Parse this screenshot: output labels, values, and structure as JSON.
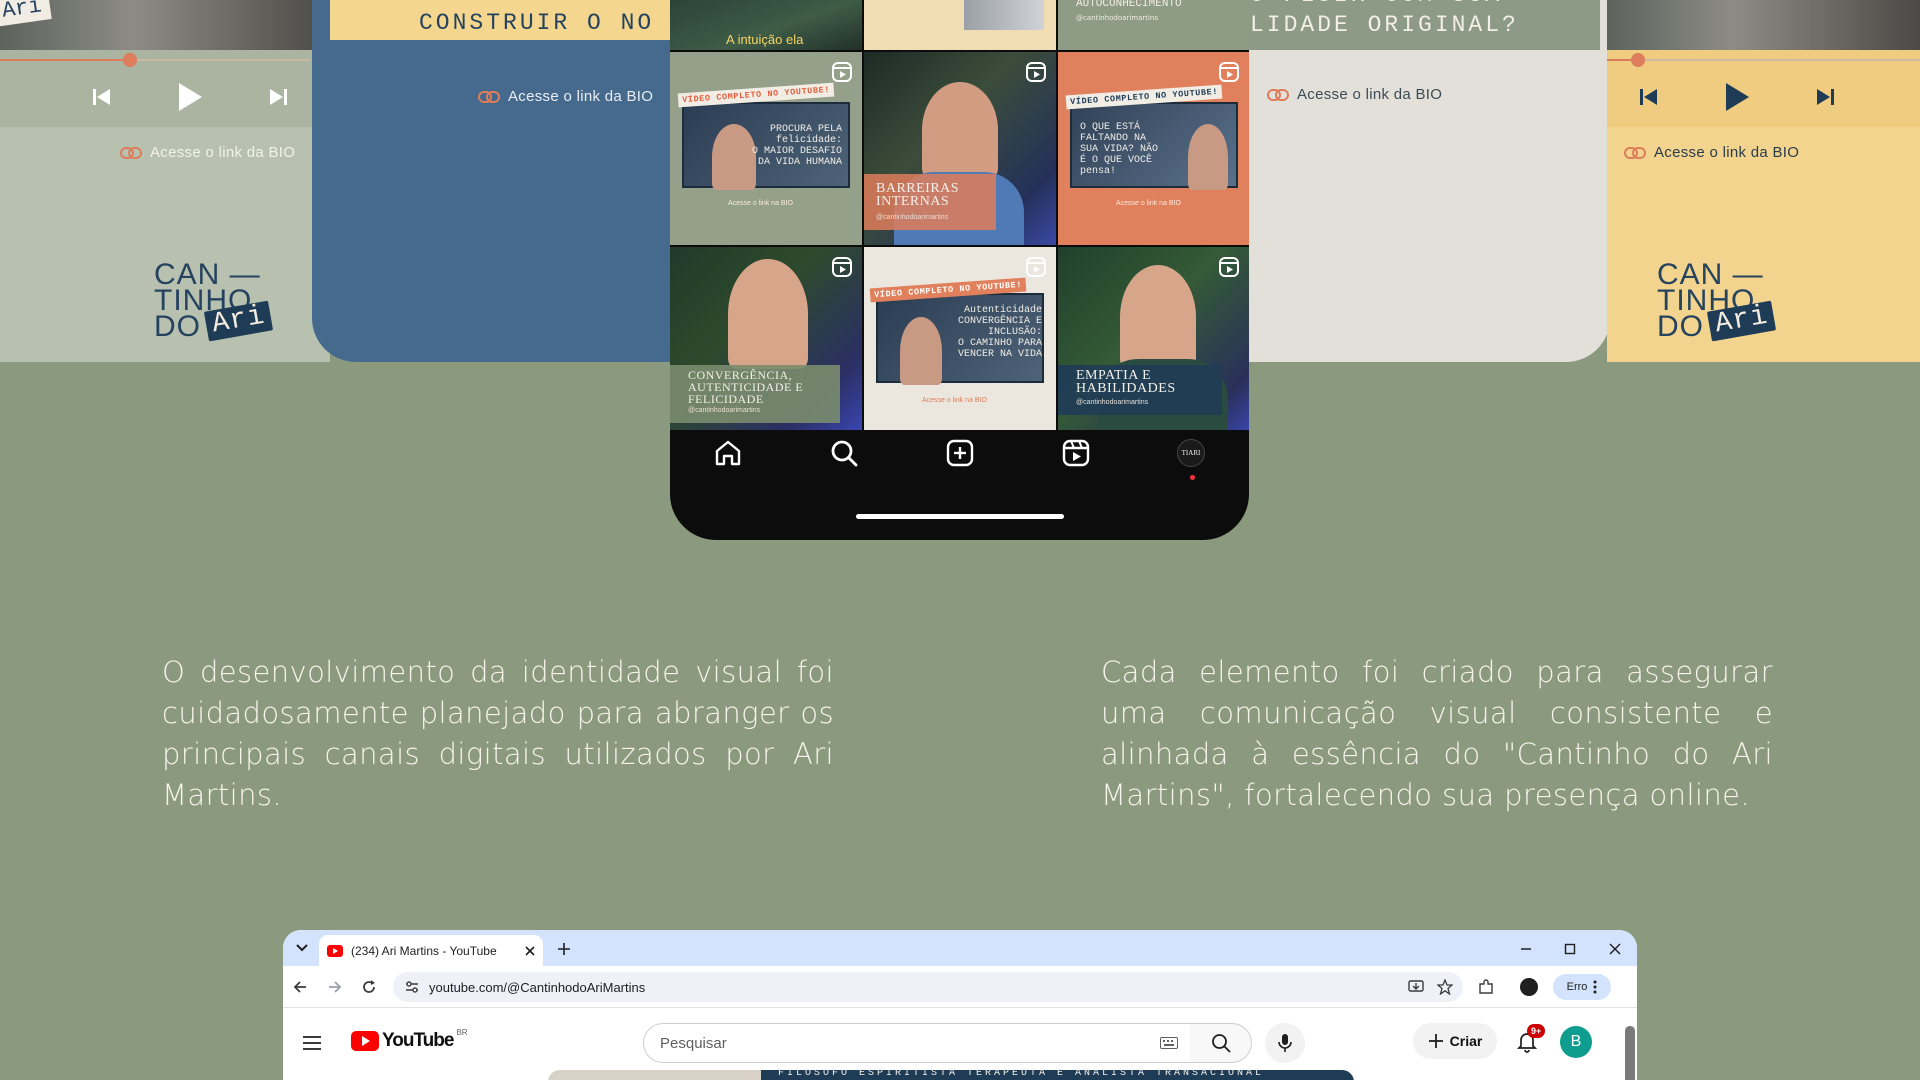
{
  "colors": {
    "background": "#8b9a7f",
    "accent_orange": "#de7d5b",
    "navy": "#25435f"
  },
  "left_card": {
    "tag_text": "Ari",
    "bio_link": "Acesse o link da BIO",
    "logo_lines": [
      "CAN —",
      "TINHO",
      "DO"
    ],
    "logo_tag": "Ari",
    "progress": 0.42
  },
  "blue_card": {
    "headline": "CONSTRUIR O NO",
    "bio_link": "Acesse o link da BIO"
  },
  "right_card": {
    "headline_lines": [
      "O FLUIR COM SUA",
      "LIDADE ORIGINAL?"
    ],
    "bio_link": "Acesse o link da BIO"
  },
  "yellow_card": {
    "bio_link": "Acesse o link da BIO",
    "logo_lines": [
      "CAN —",
      "TINHO",
      "DO"
    ],
    "logo_tag": "Ari",
    "progress": 0.1
  },
  "phone": {
    "top_row": {
      "left_caption": "A intuição ela",
      "right_caption": "AUTOCONHECIMENTO",
      "right_handle": "@cantinhodoarimartins"
    },
    "tiles": [
      {
        "banner": "VÍDEO COMPLETO NO YOUTUBE!",
        "text": "PROCURA PELA\nfelicidade:\nO MAIOR DESAFIO\nDA VIDA HUMANA",
        "bio": "Acesse o link na BIO"
      },
      {
        "caption": "BARREIRAS\nINTERNAS",
        "handle": "@cantinhodoarimartins"
      },
      {
        "banner": "VÍDEO COMPLETO NO YOUTUBE!",
        "text": "O QUE ESTÁ\nFALTANDO NA\nSUA VIDA? NÃO\nÉ O QUE VOCÊ\npensa!",
        "bio": "Acesse o link na BIO"
      },
      {
        "caption": "CONVERGÊNCIA,\nAUTENTICIDADE E\nFELICIDADE",
        "handle": "@cantinhodoarimartins"
      },
      {
        "banner": "VÍDEO COMPLETO NO YOUTUBE!",
        "text": "Autenticidade\nCONVERGÊNCIA E\nINCLUSÃO:\nO CAMINHO PARA\nVENCER NA VIDA",
        "bio": "Acesse o link na BIO"
      },
      {
        "caption": "EMPATIA E\nHABILIDADES",
        "handle": "@cantinhodoarimartins"
      }
    ],
    "nav_icons": [
      "home-icon",
      "search-icon",
      "create-icon",
      "reels-icon",
      "profile-avatar"
    ],
    "profile_avatar_text": "TIARI"
  },
  "paragraphs": {
    "left": "O desenvolvimento da identidade visual foi cuidadosamente planejado para abranger os principais canais digitais utilizados por Ari Martins.",
    "right": "Cada elemento foi criado para assegurar uma comunicação visual consistente e alinhada à essência do \"Cantinho do Ari Martins\", fortalecendo sua presença online."
  },
  "browser": {
    "tab_title": "(234) Ari Martins - YouTube",
    "url": "youtube.com/@CantinhodoAriMartins",
    "error_label": "Erro",
    "youtube": {
      "logo_text": "YouTube",
      "region": "BR",
      "search_placeholder": "Pesquisar",
      "create_label": "Criar",
      "notification_badge": "9+",
      "avatar_letter": "B",
      "banner_text": "FILÓSOFO  ESPIRITISTA  TERAPEUTA E ANALISTA TRANSACIONAL"
    }
  }
}
